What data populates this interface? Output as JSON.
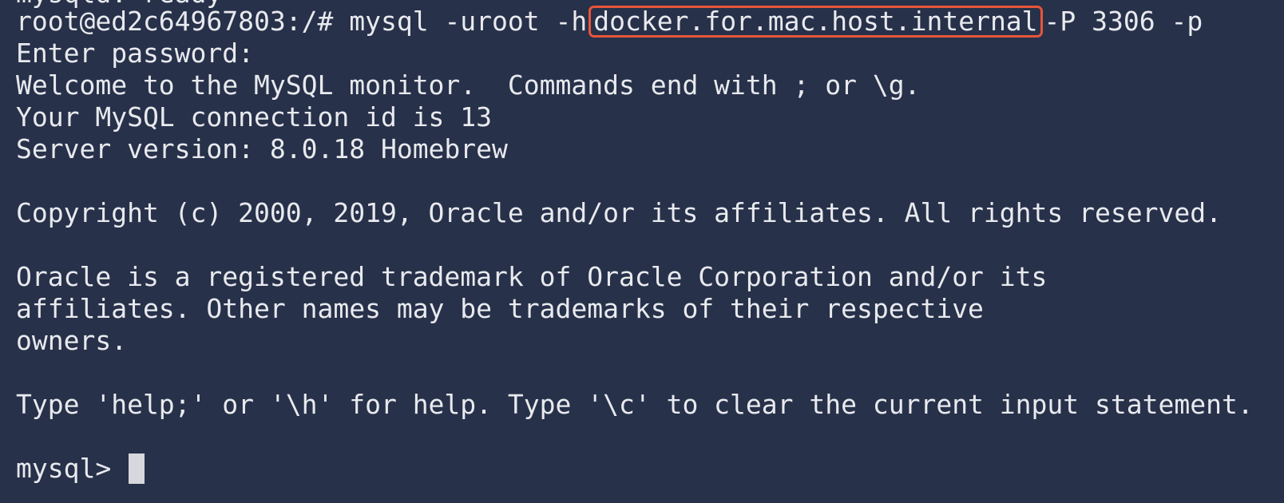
{
  "terminal": {
    "clipped_line": "mysqld: ready",
    "prompt_line": {
      "prompt": "root@ed2c64967803:/# ",
      "command_before_host": "mysql -uroot -h",
      "host": "docker.for.mac.host.internal",
      "command_after_host": "-P 3306 -p"
    },
    "output_lines": [
      "Enter password:",
      "Welcome to the MySQL monitor.  Commands end with ; or \\g.",
      "Your MySQL connection id is 13",
      "Server version: 8.0.18 Homebrew",
      "",
      "Copyright (c) 2000, 2019, Oracle and/or its affiliates. All rights reserved.",
      "",
      "Oracle is a registered trademark of Oracle Corporation and/or its",
      "affiliates. Other names may be trademarks of their respective",
      "owners.",
      "",
      "Type 'help;' or '\\h' for help. Type '\\c' to clear the current input statement.",
      ""
    ],
    "mysql_prompt": "mysql> ",
    "highlight_color": "#e7553a",
    "background_color": "#28314a",
    "text_color": "#e8eaee"
  }
}
